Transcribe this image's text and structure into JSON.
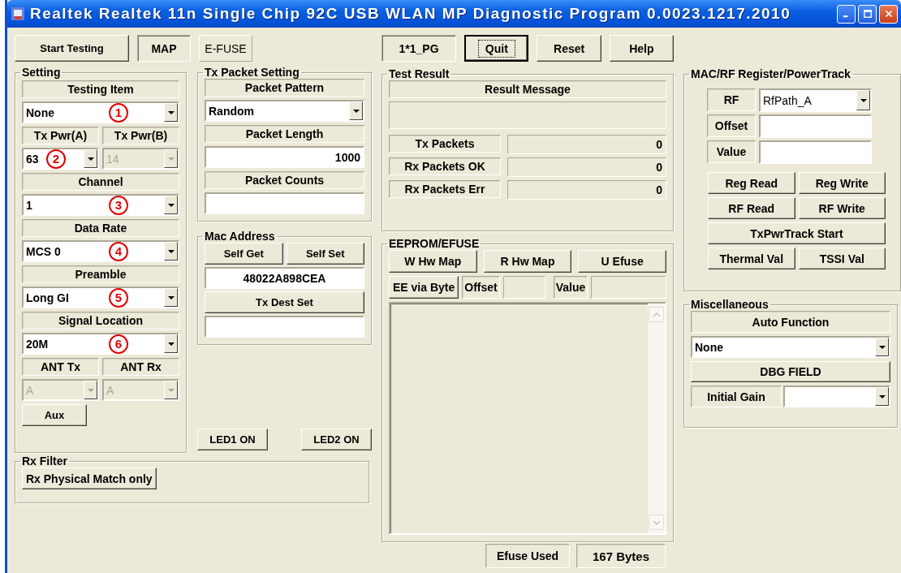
{
  "window": {
    "title": "Realtek Realtek 11n Single Chip 92C USB WLAN MP Diagnostic Program 0.0023.1217.2010"
  },
  "toolbar": {
    "start_button": "Start Testing",
    "modes": [
      {
        "label": "MAP",
        "selected": true
      },
      {
        "label": "E-FUSE",
        "selected": false
      }
    ]
  },
  "setting": {
    "title": "Setting",
    "rows": [
      {
        "kind": "label",
        "text": "Testing Item"
      },
      {
        "kind": "combo",
        "value": "None",
        "disabled": false,
        "marker": "1"
      },
      {
        "kind": "label_pair",
        "texts": [
          "Tx Pwr(A)",
          "Tx Pwr(B)"
        ]
      },
      {
        "kind": "combo_pair",
        "combos": [
          {
            "value": "63",
            "disabled": false,
            "marker": "2"
          },
          {
            "value": "14",
            "disabled": true
          }
        ]
      },
      {
        "kind": "label",
        "text": "Channel"
      },
      {
        "kind": "combo",
        "value": "1",
        "disabled": false,
        "marker": "3"
      },
      {
        "kind": "label",
        "text": "Data Rate"
      },
      {
        "kind": "combo",
        "value": "MCS 0",
        "disabled": false,
        "marker": "4"
      },
      {
        "kind": "label",
        "text": "Preamble"
      },
      {
        "kind": "combo",
        "value": "Long GI",
        "disabled": false,
        "marker": "5"
      },
      {
        "kind": "label",
        "text": "Signal Location"
      },
      {
        "kind": "combo",
        "value": "20M",
        "disabled": false,
        "marker": "6"
      },
      {
        "kind": "label_pair",
        "texts": [
          "ANT Tx",
          "ANT Rx"
        ]
      },
      {
        "kind": "combo_pair",
        "combos": [
          {
            "value": "A",
            "disabled": true
          },
          {
            "value": "A",
            "disabled": true
          }
        ]
      },
      {
        "kind": "button",
        "text": "Aux"
      }
    ]
  },
  "tx_packet_setting": {
    "title": "Tx Packet Setting",
    "rows": [
      {
        "kind": "label",
        "text": "Packet Pattern"
      },
      {
        "kind": "combo",
        "value": "Random",
        "disabled": false
      },
      {
        "kind": "label",
        "text": "Packet Length"
      },
      {
        "kind": "field",
        "value": "1000"
      },
      {
        "kind": "label",
        "text": "Packet Counts"
      },
      {
        "kind": "field"
      }
    ]
  },
  "mac_address": {
    "title": "Mac Address",
    "buttons": [
      "Self Get",
      "Self Set"
    ],
    "address": "48022A898CEA",
    "dest_button": "Tx Dest Set"
  },
  "led_buttons": [
    "LED1 ON",
    "LED2 ON"
  ],
  "rx_filter": {
    "title": "Rx Filter",
    "button": "Rx Physical Match only"
  },
  "center_toolbar": {
    "mode_label": "1*1_PG",
    "buttons": [
      {
        "label": "Quit",
        "focused": true
      },
      {
        "label": "Reset",
        "focused": false
      },
      {
        "label": "Help",
        "focused": false
      }
    ]
  },
  "test_result": {
    "title": "Test Result",
    "header": "Result Message",
    "counters": [
      {
        "label": "Tx Packets",
        "value": "0"
      },
      {
        "label": "Rx Packets OK",
        "value": "0"
      },
      {
        "label": "Rx Packets Err",
        "value": "0"
      }
    ]
  },
  "eeprom": {
    "title": "EEPROM/EFUSE",
    "buttons": [
      "W Hw Map",
      "R Hw Map",
      "U Efuse"
    ],
    "byte_button": "EE via Byte",
    "offset_label": "Offset",
    "value_label": "Value"
  },
  "efuse_status": {
    "label": "Efuse Used",
    "value": "167 Bytes"
  },
  "mac_rf": {
    "title": "MAC/RF Register/PowerTrack",
    "rf_label": "RF",
    "rf_value": "RfPath_A",
    "offset_label": "Offset",
    "value_label": "Value",
    "button_rows": [
      [
        "Reg Read",
        "Reg Write"
      ],
      [
        "RF Read",
        "RF Write"
      ],
      [
        "TxPwrTrack Start"
      ],
      [
        "Thermal Val",
        "TSSI Val"
      ]
    ]
  },
  "misc": {
    "title": "Miscellaneous",
    "auto_label": "Auto Function",
    "auto_value": "None",
    "dbg_button": "DBG FIELD",
    "gain_label": "Initial Gain"
  }
}
